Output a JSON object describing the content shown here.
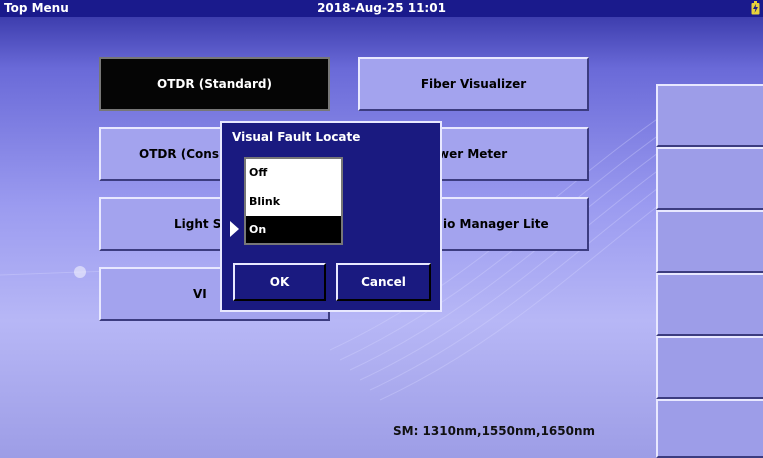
{
  "titlebar": {
    "title": "Top Menu",
    "datetime": "2018-Aug-25 11:01",
    "battery_icon": "battery-charging-icon"
  },
  "menu": {
    "otdr_standard": "OTDR (Standard)",
    "fiber_visualizer": "Fiber Visualizer",
    "otdr_cons": "OTDR (Cons",
    "power_meter": "wer Meter",
    "light_source": "Light S",
    "audio_manager": "io Manager Lite",
    "vip": "VI"
  },
  "status": {
    "wavelengths": "SM: 1310nm,1550nm,1650nm"
  },
  "dialog": {
    "title": "Visual Fault Locate",
    "options": [
      "Off",
      "Blink",
      "On"
    ],
    "selected": "On",
    "ok_label": "OK",
    "cancel_label": "Cancel"
  },
  "colors": {
    "titlebar": "#1a1a8c",
    "dialog_bg": "#1a1a80",
    "button_bg": "#a3a3ee",
    "selected_bg": "#050505"
  }
}
